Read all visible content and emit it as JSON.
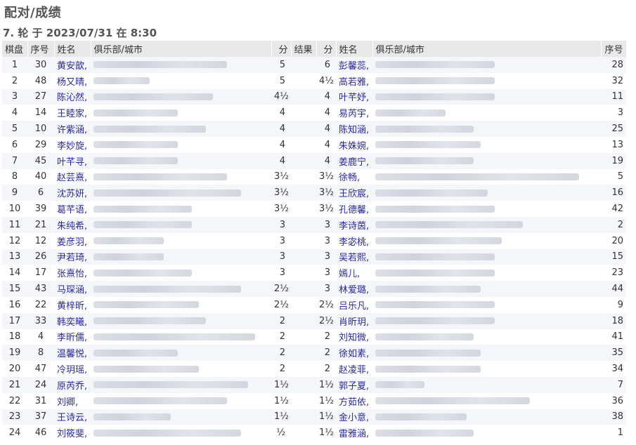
{
  "page": {
    "title": "配对/成绩",
    "round": "7. 轮 于 2023/07/31 在 8:30"
  },
  "table": {
    "headers": [
      "棋盘",
      "序号",
      "姓名",
      "俱乐部/城市",
      "分",
      "结果",
      "分",
      "姓名",
      "俱乐部/城市",
      "序号"
    ],
    "rows": [
      {
        "board": "1",
        "no1": "30",
        "name1": "黄安歆,",
        "pts1": "5",
        "result": "",
        "pts2": "6",
        "name2": "彭馨蕊,",
        "no2": "28"
      },
      {
        "board": "2",
        "no1": "48",
        "name1": "杨又晴,",
        "pts1": "5",
        "result": "",
        "pts2": "4½",
        "name2": "高若雅,",
        "no2": "32"
      },
      {
        "board": "3",
        "no1": "27",
        "name1": "陈沁然,",
        "pts1": "4½",
        "result": "",
        "pts2": "4",
        "name2": "叶芊妤,",
        "no2": "11"
      },
      {
        "board": "4",
        "no1": "14",
        "name1": "王睦家,",
        "pts1": "4",
        "result": "",
        "pts2": "4",
        "name2": "易芮宇,",
        "no2": "3"
      },
      {
        "board": "5",
        "no1": "10",
        "name1": "许紫涵,",
        "pts1": "4",
        "result": "",
        "pts2": "4",
        "name2": "陈知涵,",
        "no2": "25"
      },
      {
        "board": "6",
        "no1": "29",
        "name1": "李妙旋,",
        "pts1": "4",
        "result": "",
        "pts2": "4",
        "name2": "朱姝婉,",
        "no2": "13"
      },
      {
        "board": "7",
        "no1": "45",
        "name1": "叶芊寻,",
        "pts1": "4",
        "result": "",
        "pts2": "4",
        "name2": "姜鹿宁,",
        "no2": "19"
      },
      {
        "board": "8",
        "no1": "40",
        "name1": "赵芸熹,",
        "pts1": "3½",
        "result": "",
        "pts2": "3½",
        "name2": "徐畅,",
        "no2": "5"
      },
      {
        "board": "9",
        "no1": "6",
        "name1": "沈苏妍,",
        "pts1": "3½",
        "result": "",
        "pts2": "3½",
        "name2": "王欣宸,",
        "no2": "16"
      },
      {
        "board": "10",
        "no1": "39",
        "name1": "葛芊语,",
        "pts1": "3½",
        "result": "",
        "pts2": "3½",
        "name2": "孔德馨,",
        "no2": "42"
      },
      {
        "board": "11",
        "no1": "21",
        "name1": "朱纯希,",
        "pts1": "3",
        "result": "",
        "pts2": "3",
        "name2": "李诗茵,",
        "no2": "2"
      },
      {
        "board": "12",
        "no1": "12",
        "name1": "姜彦羽,",
        "pts1": "3",
        "result": "",
        "pts2": "3",
        "name2": "李宓桃,",
        "no2": "20"
      },
      {
        "board": "13",
        "no1": "26",
        "name1": "尹若琦,",
        "pts1": "3",
        "result": "",
        "pts2": "3",
        "name2": "吴若熙,",
        "no2": "15"
      },
      {
        "board": "14",
        "no1": "17",
        "name1": "张熹怡,",
        "pts1": "3",
        "result": "",
        "pts2": "3",
        "name2": "嫣儿,",
        "no2": "23"
      },
      {
        "board": "15",
        "no1": "43",
        "name1": "马琛涵,",
        "pts1": "2½",
        "result": "",
        "pts2": "3",
        "name2": "林爱璐,",
        "no2": "44"
      },
      {
        "board": "16",
        "no1": "22",
        "name1": "黄梓昕,",
        "pts1": "2½",
        "result": "",
        "pts2": "2½",
        "name2": "吕乐凡,",
        "no2": "9"
      },
      {
        "board": "17",
        "no1": "33",
        "name1": "韩奕曦,",
        "pts1": "2",
        "result": "",
        "pts2": "2½",
        "name2": "肖昕玥,",
        "no2": "18"
      },
      {
        "board": "18",
        "no1": "4",
        "name1": "李昕儒,",
        "pts1": "2",
        "result": "",
        "pts2": "2",
        "name2": "刘知微,",
        "no2": "41"
      },
      {
        "board": "19",
        "no1": "8",
        "name1": "温馨悦,",
        "pts1": "2",
        "result": "",
        "pts2": "2",
        "name2": "徐如素,",
        "no2": "35"
      },
      {
        "board": "20",
        "no1": "47",
        "name1": "冷玥瑶,",
        "pts1": "2",
        "result": "",
        "pts2": "2",
        "name2": "赵凌菲,",
        "no2": "34"
      },
      {
        "board": "21",
        "no1": "24",
        "name1": "原芮乔,",
        "pts1": "1½",
        "result": "",
        "pts2": "1½",
        "name2": "郭子夏,",
        "no2": "7"
      },
      {
        "board": "22",
        "no1": "31",
        "name1": "刘卿,",
        "pts1": "1½",
        "result": "",
        "pts2": "1½",
        "name2": "方茹依,",
        "no2": "36"
      },
      {
        "board": "23",
        "no1": "37",
        "name1": "王诗云,",
        "pts1": "1½",
        "result": "",
        "pts2": "1½",
        "name2": "金小意,",
        "no2": "38"
      },
      {
        "board": "24",
        "no1": "46",
        "name1": "刘筱斐,",
        "pts1": "½",
        "result": "",
        "pts2": "1½",
        "name2": "雷雅涵,",
        "no2": "1"
      }
    ]
  }
}
